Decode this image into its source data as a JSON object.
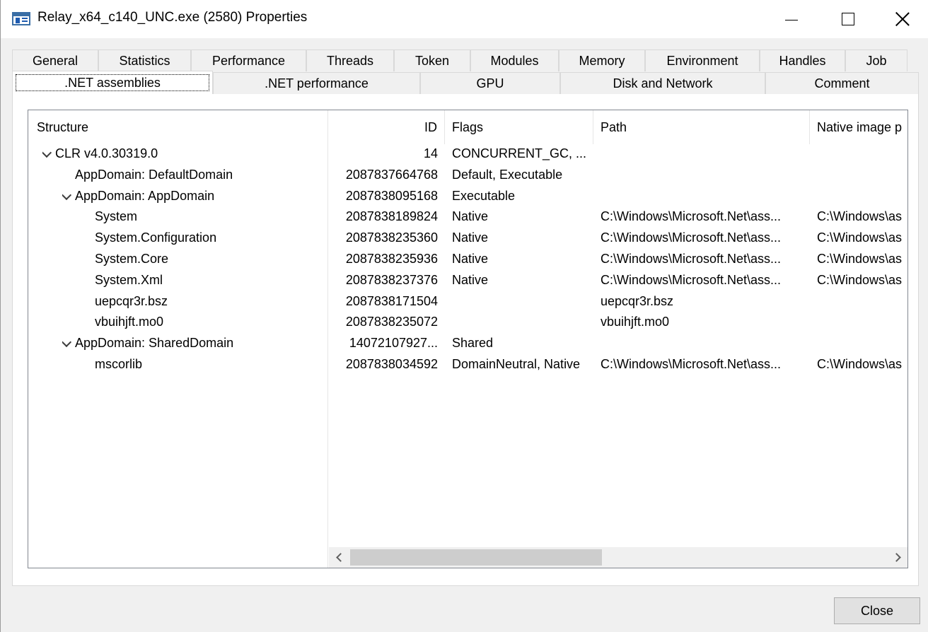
{
  "window": {
    "title": "Relay_x64_c140_UNC.exe (2580) Properties"
  },
  "tabs_row1": [
    "General",
    "Statistics",
    "Performance",
    "Threads",
    "Token",
    "Modules",
    "Memory",
    "Environment",
    "Handles",
    "Job"
  ],
  "tabs_row2": [
    ".NET assemblies",
    ".NET performance",
    "GPU",
    "Disk and Network",
    "Comment"
  ],
  "active_tab": ".NET assemblies",
  "grid": {
    "headers": {
      "structure": "Structure",
      "id": "ID",
      "flags": "Flags",
      "path": "Path",
      "native_image_path": "Native image p"
    },
    "rows": [
      {
        "structure": "CLR v4.0.30319.0",
        "expander": true,
        "id": "14",
        "flags": "CONCURRENT_GC, ...",
        "path": "",
        "native": ""
      },
      {
        "structure": "AppDomain: DefaultDomain",
        "expander": false,
        "id": "2087837664768",
        "flags": "Default, Executable",
        "path": "",
        "native": ""
      },
      {
        "structure": "AppDomain: AppDomain",
        "expander": true,
        "id": "2087838095168",
        "flags": "Executable",
        "path": "",
        "native": ""
      },
      {
        "structure": "System",
        "expander": false,
        "id": "2087838189824",
        "flags": "Native",
        "path": "C:\\Windows\\Microsoft.Net\\ass...",
        "native": "C:\\Windows\\as"
      },
      {
        "structure": "System.Configuration",
        "expander": false,
        "id": "2087838235360",
        "flags": "Native",
        "path": "C:\\Windows\\Microsoft.Net\\ass...",
        "native": "C:\\Windows\\as"
      },
      {
        "structure": "System.Core",
        "expander": false,
        "id": "2087838235936",
        "flags": "Native",
        "path": "C:\\Windows\\Microsoft.Net\\ass...",
        "native": "C:\\Windows\\as"
      },
      {
        "structure": "System.Xml",
        "expander": false,
        "id": "2087838237376",
        "flags": "Native",
        "path": "C:\\Windows\\Microsoft.Net\\ass...",
        "native": "C:\\Windows\\as"
      },
      {
        "structure": "uepcqr3r.bsz",
        "expander": false,
        "id": "2087838171504",
        "flags": "",
        "path": "uepcqr3r.bsz",
        "native": ""
      },
      {
        "structure": "vbuihjft.mo0",
        "expander": false,
        "id": "2087838235072",
        "flags": "",
        "path": "vbuihjft.mo0",
        "native": ""
      },
      {
        "structure": "AppDomain: SharedDomain",
        "expander": true,
        "id": "14072107927...",
        "flags": "Shared",
        "path": "",
        "native": ""
      },
      {
        "structure": "mscorlib",
        "expander": false,
        "id": "2087838034592",
        "flags": "DomainNeutral, Native",
        "path": "C:\\Windows\\Microsoft.Net\\ass...",
        "native": "C:\\Windows\\as"
      }
    ]
  },
  "buttons": {
    "close": "Close"
  },
  "colors": {
    "panel_bg": "#ffffff",
    "window_bg": "#f0f0f0",
    "scroll_thumb": "#cdcdcd"
  }
}
